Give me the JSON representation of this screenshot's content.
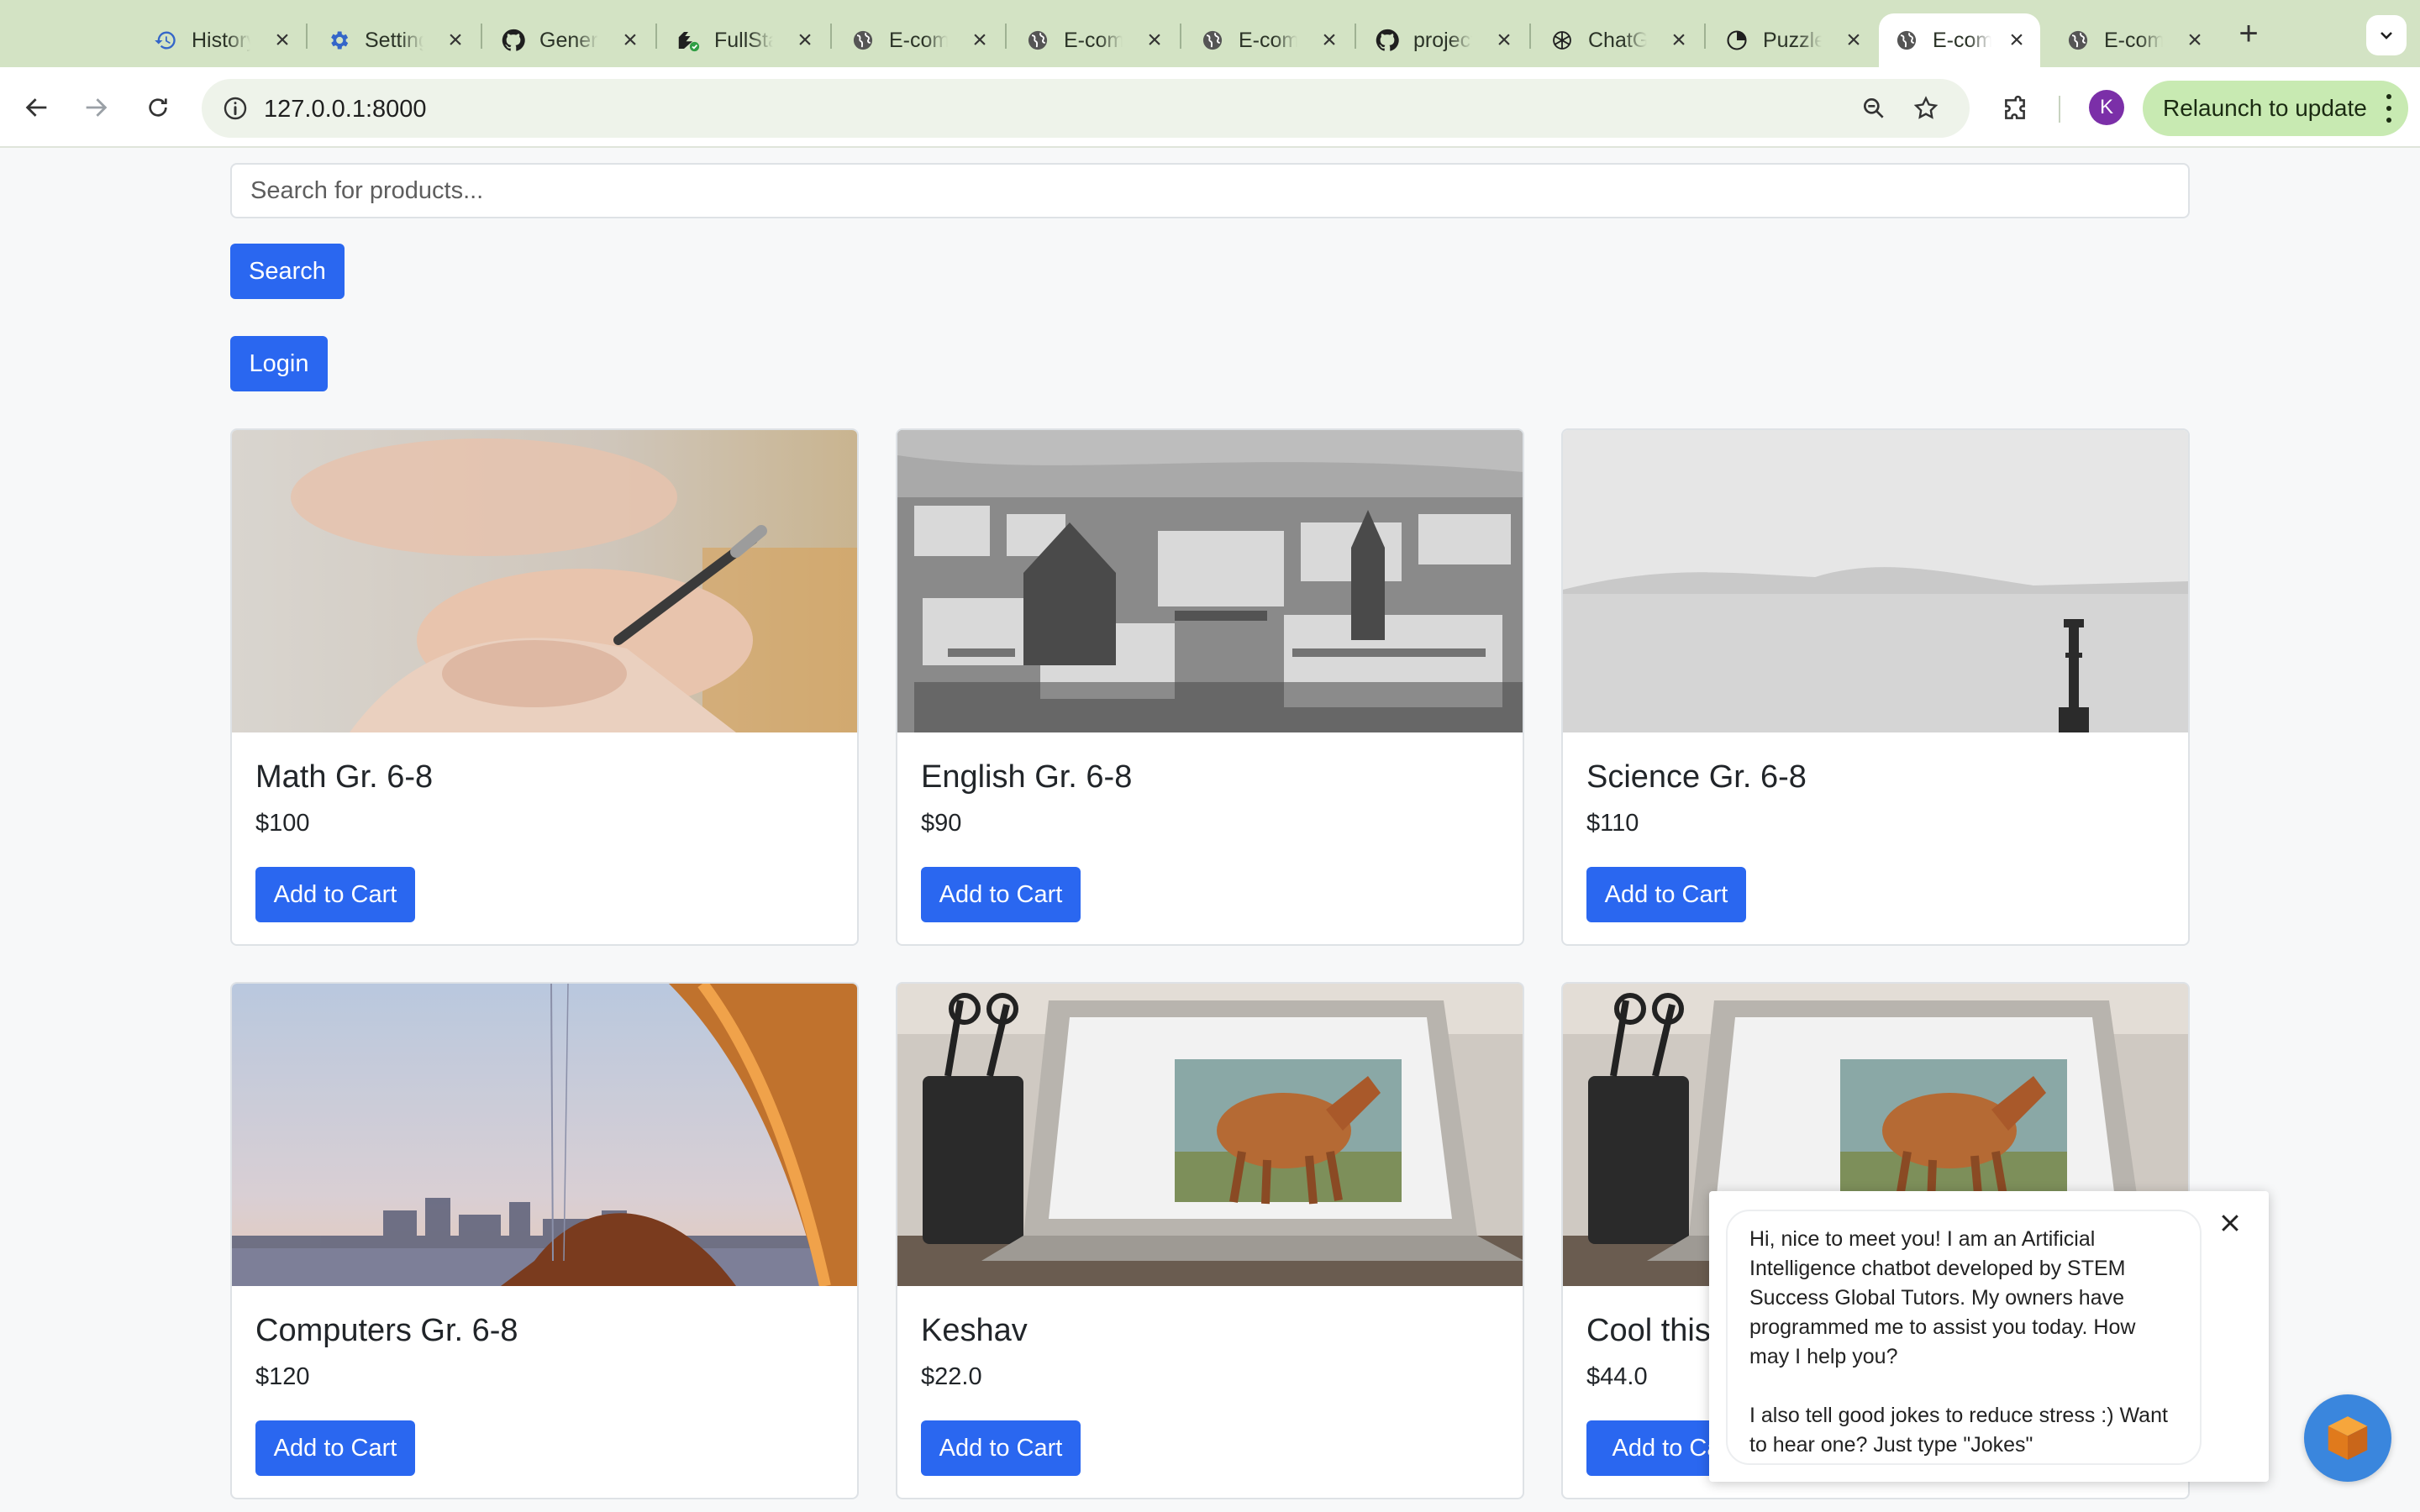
{
  "browser": {
    "tabs": [
      {
        "title": "History",
        "icon": "history-icon"
      },
      {
        "title": "Settings",
        "icon": "settings-gear-icon"
      },
      {
        "title": "Generate",
        "icon": "github-icon"
      },
      {
        "title": "FullStack",
        "icon": "fullstack-icon"
      },
      {
        "title": "E-commerce",
        "icon": "globe-icon"
      },
      {
        "title": "E-commerce",
        "icon": "globe-icon"
      },
      {
        "title": "E-commerce",
        "icon": "globe-icon"
      },
      {
        "title": "project",
        "icon": "github-icon"
      },
      {
        "title": "ChatGPT",
        "icon": "chatgpt-icon"
      },
      {
        "title": "Puzzle",
        "icon": "puzzle-icon"
      },
      {
        "title": "E-commerce",
        "icon": "globe-icon",
        "active": true
      },
      {
        "title": "E-commerce",
        "icon": "globe-icon"
      }
    ],
    "url": "127.0.0.1:8000",
    "profile_initial": "K",
    "relaunch_label": "Relaunch to update"
  },
  "page": {
    "search_placeholder": "Search for products...",
    "search_button": "Search",
    "login_button": "Login",
    "products": [
      {
        "name": "Math Gr. 6-8",
        "price": "$100",
        "button": "Add to Cart",
        "image": "hands-writing-pen"
      },
      {
        "name": "English Gr. 6-8",
        "price": "$90",
        "button": "Add to Cart",
        "image": "city-aerial-bw"
      },
      {
        "name": "Science Gr. 6-8",
        "price": "$110",
        "button": "Add to Cart",
        "image": "sea-horizon-bw"
      },
      {
        "name": "Computers Gr. 6-8",
        "price": "$120",
        "button": "Add to Cart",
        "image": "harbor-skyline"
      },
      {
        "name": "Keshav",
        "price": "$22.0",
        "button": "Add to Cart",
        "image": "laptop-horse"
      },
      {
        "name": "Cool this",
        "price": "$44.0",
        "button": "Add to Ca",
        "image": "laptop-horse"
      }
    ]
  },
  "chatbot": {
    "message_1": "Hi, nice to meet you! I am an Artificial Intelligence chatbot developed by STEM Success Global Tutors. My owners have programmed me to assist you today. How may I help you?",
    "message_2": "I also tell good jokes to reduce stress :) Want to hear one? Just type \"Jokes\""
  },
  "colors": {
    "tabstrip": "#d3e3c4",
    "primary_button": "#2a67f0",
    "relaunch": "#c8eab2",
    "avatar": "#7b2fa8"
  }
}
